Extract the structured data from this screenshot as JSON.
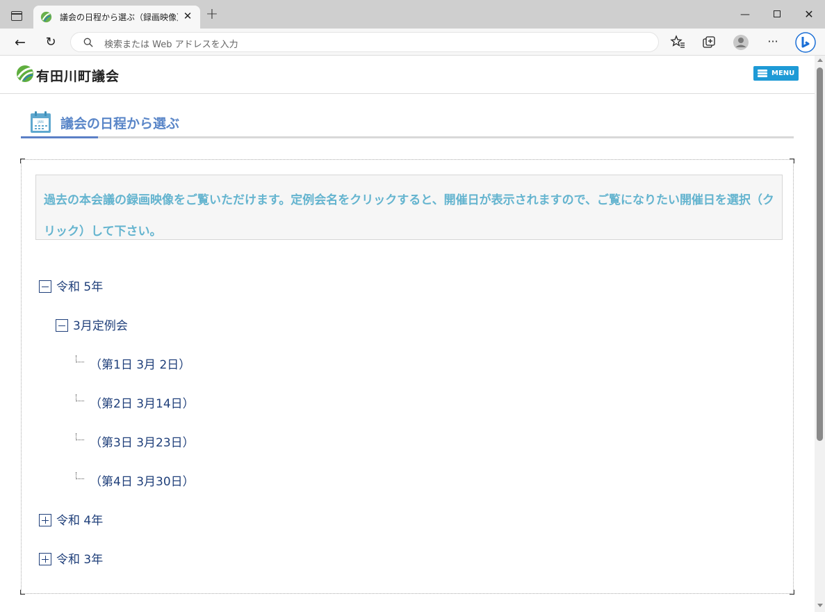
{
  "browser": {
    "tab_title": "議会の日程から選ぶ（録画映像）",
    "address_placeholder": "検索または Web アドレスを入力",
    "new_tab": "+",
    "close_tab": "✕",
    "minimize": "—",
    "close_window": "✕",
    "back": "←",
    "reload": "↻",
    "more": "···"
  },
  "site": {
    "logo_text": "有田川町議会",
    "menu_label": "MENU"
  },
  "heading": {
    "title": "議会の日程から選ぶ",
    "icon_label": "JAN"
  },
  "notice": "過去の本会議の録画映像をご覧いただけます。定例会名をクリックすると、開催日が表示されますので、ご覧になりたい開催日を選択（クリック）して下さい。",
  "tree": {
    "years": [
      {
        "label": "令和 5年",
        "expanded": true,
        "sessions": [
          {
            "label": "3月定例会",
            "expanded": true,
            "days": [
              "（第1日 3月 2日）",
              "（第2日 3月14日）",
              "（第3日 3月23日）",
              "（第4日 3月30日）"
            ]
          }
        ]
      },
      {
        "label": "令和 4年",
        "expanded": false
      },
      {
        "label": "令和 3年",
        "expanded": false
      }
    ]
  },
  "colors": {
    "menu_bg": "#1e9ad6",
    "heading": "#5a86c8",
    "notice_text": "#64b4cf",
    "tree_text": "#1f3f7a"
  }
}
